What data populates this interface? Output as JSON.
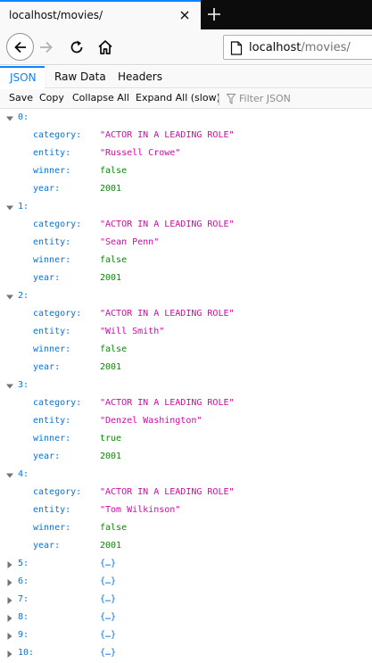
{
  "browser": {
    "tab_title": "localhost/movies/",
    "url_host": "localhost",
    "url_path": "/movies/"
  },
  "viewer": {
    "tabs": [
      {
        "label": "JSON"
      },
      {
        "label": "Raw Data"
      },
      {
        "label": "Headers"
      }
    ],
    "toolbar": {
      "save": "Save",
      "copy": "Copy",
      "collapse_all": "Collapse All",
      "expand_all": "Expand All (slow)",
      "filter_placeholder": "Filter JSON"
    }
  },
  "keys": {
    "category": "category:",
    "entity": "entity:",
    "winner": "winner:",
    "year": "year:"
  },
  "records": [
    {
      "index": "0:",
      "category": "\"ACTOR IN A LEADING ROLE\"",
      "entity": "\"Russell Crowe\"",
      "winner": "false",
      "year": "2001"
    },
    {
      "index": "1:",
      "category": "\"ACTOR IN A LEADING ROLE\"",
      "entity": "\"Sean Penn\"",
      "winner": "false",
      "year": "2001"
    },
    {
      "index": "2:",
      "category": "\"ACTOR IN A LEADING ROLE\"",
      "entity": "\"Will Smith\"",
      "winner": "false",
      "year": "2001"
    },
    {
      "index": "3:",
      "category": "\"ACTOR IN A LEADING ROLE\"",
      "entity": "\"Denzel Washington\"",
      "winner": "true",
      "year": "2001"
    },
    {
      "index": "4:",
      "category": "\"ACTOR IN A LEADING ROLE\"",
      "entity": "\"Tom Wilkinson\"",
      "winner": "false",
      "year": "2001"
    }
  ],
  "collapsed": [
    {
      "index": "5:",
      "summary": "{…}"
    },
    {
      "index": "6:",
      "summary": "{…}"
    },
    {
      "index": "7:",
      "summary": "{…}"
    },
    {
      "index": "8:",
      "summary": "{…}"
    },
    {
      "index": "9:",
      "summary": "{…}"
    },
    {
      "index": "10:",
      "summary": "{…}"
    }
  ],
  "colors": {
    "accent": "#0a84ff",
    "key": "#0074e8",
    "string": "#dd00a9",
    "literal": "#058b00"
  }
}
